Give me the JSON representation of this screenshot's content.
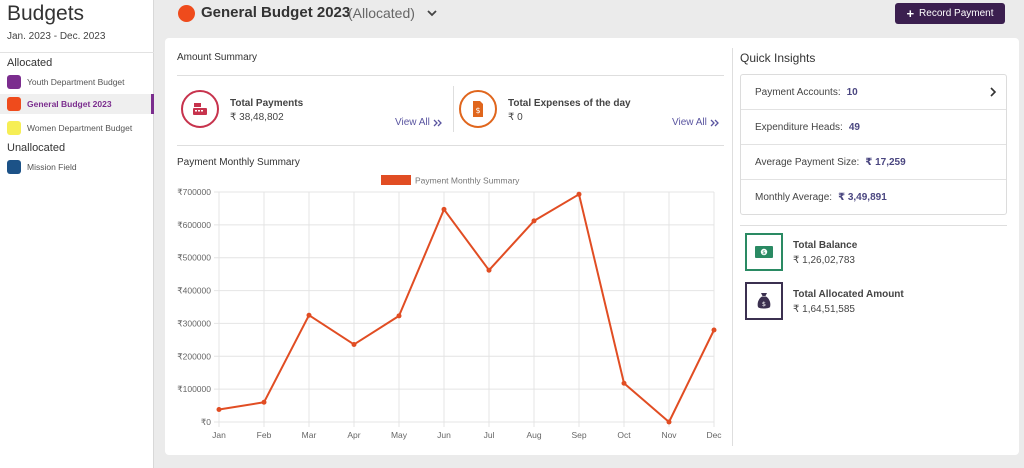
{
  "sidebar": {
    "title": "Budgets",
    "date_range": "Jan. 2023 - Dec. 2023",
    "groups": [
      {
        "label": "Allocated",
        "items": [
          {
            "label": "Youth Department Budget",
            "color": "#7b2d8e"
          },
          {
            "label": "General Budget 2023",
            "color": "#ef4b1c",
            "active": true
          },
          {
            "label": "Women Department Budget",
            "color": "#f6ee55"
          }
        ]
      },
      {
        "label": "Unallocated",
        "items": [
          {
            "label": "Mission Field",
            "color": "#1c5287"
          }
        ]
      }
    ]
  },
  "header": {
    "title": "General Budget 2023",
    "status": "(Allocated)",
    "dot_color": "#ef4b1c",
    "record_button": "Record Payment",
    "record_button_color": "#3b1f4f"
  },
  "amount_summary": {
    "title": "Amount Summary",
    "payments": {
      "label": "Total Payments",
      "value": "₹ 38,48,802",
      "link": "View All",
      "color": "#c7334d",
      "icon": "cash-register-icon"
    },
    "expenses": {
      "label": "Total Expenses of the day",
      "value": "₹ 0",
      "link": "View All",
      "color": "#e0661d",
      "icon": "money-bill-icon"
    }
  },
  "monthly_summary": {
    "title": "Payment Monthly Summary"
  },
  "chart_data": {
    "type": "line",
    "categories": [
      "Jan",
      "Feb",
      "Mar",
      "Apr",
      "May",
      "Jun",
      "Jul",
      "Aug",
      "Sep",
      "Oct",
      "Nov",
      "Dec"
    ],
    "series": [
      {
        "name": "Payment Monthly Summary",
        "color": "#e14d23",
        "values": [
          38000,
          60000,
          325000,
          236000,
          323000,
          647000,
          462000,
          612000,
          693000,
          118000,
          0,
          280000
        ]
      }
    ],
    "y_ticks": [
      "₹0",
      "₹100000",
      "₹200000",
      "₹300000",
      "₹400000",
      "₹500000",
      "₹600000",
      "₹700000"
    ],
    "ylim": [
      0,
      700000
    ],
    "grid": true,
    "legend": "top-center"
  },
  "quick_insights": {
    "title": "Quick Insights",
    "rows": [
      {
        "label": "Payment Accounts:",
        "value": "10"
      },
      {
        "label": "Expenditure Heads:",
        "value": "49"
      },
      {
        "label": "Average Payment Size:",
        "value": "₹ 17,259"
      },
      {
        "label": "Monthly Average:",
        "value": "₹ 3,49,891"
      }
    ]
  },
  "balances": {
    "total_balance": {
      "label": "Total Balance",
      "value": "₹ 1,26,02,783",
      "color": "#2a8a63",
      "icon": "money-bill-icon"
    },
    "total_allocated": {
      "label": "Total Allocated Amount",
      "value": "₹ 1,64,51,585",
      "color": "#3b3050",
      "icon": "money-bag-icon"
    }
  }
}
